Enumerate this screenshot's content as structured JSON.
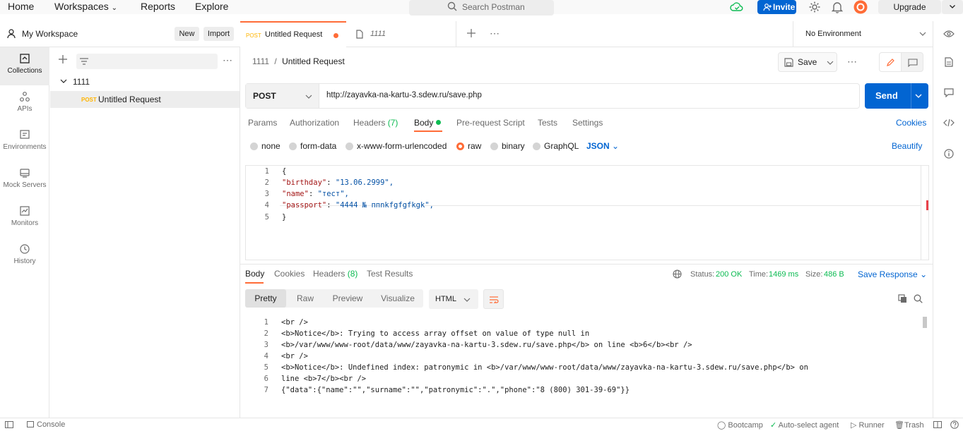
{
  "topbar": {
    "nav": [
      "Home",
      "Workspaces",
      "Reports",
      "Explore"
    ],
    "search_placeholder": "Search Postman",
    "invite_label": "Invite",
    "upgrade_label": "Upgrade"
  },
  "workspace": {
    "title": "My Workspace",
    "new_label": "New",
    "import_label": "Import"
  },
  "rail": [
    {
      "label": "Collections",
      "icon": "collections-icon"
    },
    {
      "label": "APIs",
      "icon": "apis-icon"
    },
    {
      "label": "Environments",
      "icon": "environments-icon"
    },
    {
      "label": "Mock Servers",
      "icon": "mock-servers-icon"
    },
    {
      "label": "Monitors",
      "icon": "monitors-icon"
    },
    {
      "label": "History",
      "icon": "history-icon"
    }
  ],
  "tree": {
    "collection": "1111",
    "request_method": "POST",
    "request_name": "Untitled Request"
  },
  "tabs": [
    {
      "method": "POST",
      "label": "Untitled Request"
    },
    {
      "label": "1111"
    }
  ],
  "environment": "No Environment",
  "breadcrumb": {
    "parent": "1111",
    "separator": "/",
    "current": "Untitled Request"
  },
  "save_label": "Save",
  "request": {
    "method": "POST",
    "url": "http://zayavka-na-kartu-3.sdew.ru/save.php",
    "send_label": "Send",
    "tabs": [
      "Params",
      "Authorization",
      "Headers",
      "Body",
      "Pre-request Script",
      "Tests",
      "Settings"
    ],
    "headers_count": "(7)",
    "cookies_label": "Cookies",
    "body_modes": [
      "none",
      "form-data",
      "x-www-form-urlencoded",
      "raw",
      "binary",
      "GraphQL"
    ],
    "raw_format": "JSON",
    "beautify_label": "Beautify",
    "body_lines": [
      {
        "n": "1",
        "t": "{"
      },
      {
        "n": "2",
        "k": "\"birthday\"",
        "v": "\"13.06.2999\","
      },
      {
        "n": "3",
        "k": "\"name\"",
        "v": "\"тест\","
      },
      {
        "n": "4",
        "k": "\"passport\"",
        "v": "\"4444 № ппnkfgfgfkgk\","
      },
      {
        "n": "5",
        "t": "}"
      }
    ]
  },
  "response": {
    "tabs": [
      "Body",
      "Cookies",
      "Headers",
      "Test Results"
    ],
    "headers_count": "(8)",
    "status_label": "Status:",
    "status_value": "200 OK",
    "time_label": "Time:",
    "time_value": "1469 ms",
    "size_label": "Size:",
    "size_value": "486 B",
    "save_response_label": "Save Response",
    "views": [
      "Pretty",
      "Raw",
      "Preview",
      "Visualize"
    ],
    "format": "HTML",
    "lines": [
      {
        "n": "1",
        "t": "<br />"
      },
      {
        "n": "2",
        "t": "<b>Notice</b>: Trying to access array offset on value of type null in"
      },
      {
        "n": "3",
        "t": "<b>/var/www/www-root/data/www/zayavka-na-kartu-3.sdew.ru/save.php</b> on line <b>6</b><br />"
      },
      {
        "n": "4",
        "t": "<br />"
      },
      {
        "n": "5",
        "t": "<b>Notice</b>: Undefined index: patronymic in <b>/var/www/www-root/data/www/zayavka-na-kartu-3.sdew.ru/save.php</b> on"
      },
      {
        "n": "6",
        "t": "line <b>7</b><br />"
      },
      {
        "n": "7",
        "t": "{\"data\":{\"name\":\"\",\"surname\":\"\",\"patronymic\":\".\",\"phone\":\"8 (800) 301-39-69\"}}"
      }
    ]
  },
  "footer": {
    "console": "Console",
    "bootcamp": "Bootcamp",
    "auto_select": "Auto-select agent",
    "runner": "Runner",
    "trash": "Trash"
  },
  "colors": {
    "accent": "#ff6c37",
    "primary": "#0265d2",
    "success": "#0cbb52"
  }
}
